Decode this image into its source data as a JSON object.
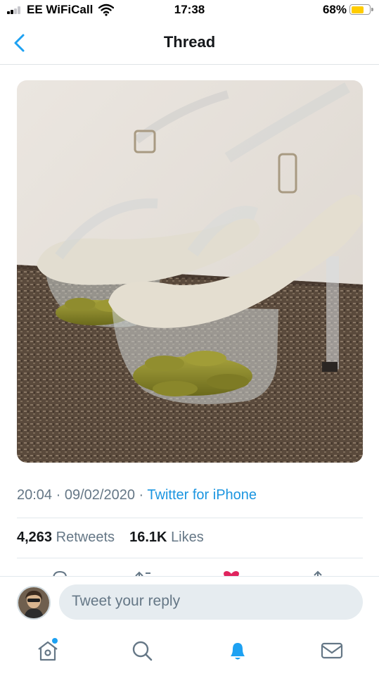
{
  "status_bar": {
    "carrier": "EE WiFiCall",
    "time": "17:38",
    "battery_pct": "68%",
    "battery_level": 0.68,
    "icons": [
      "cell-signal-icon",
      "wifi-icon",
      "battery-icon"
    ]
  },
  "nav": {
    "title": "Thread",
    "back_icon": "chevron-left-icon"
  },
  "tweet": {
    "time": "20:04",
    "date": "09/02/2020",
    "separator": "·",
    "source": "Twitter for iPhone",
    "retweets_count": "4,263",
    "retweets_label": "Retweets",
    "likes_count": "16.1K",
    "likes_label": "Likes"
  },
  "reply": {
    "placeholder": "Tweet your reply"
  },
  "tab_bar": {
    "items": [
      "home-icon",
      "search-icon",
      "notifications-icon",
      "messages-icon"
    ],
    "active": "notifications-icon"
  },
  "colors": {
    "accent": "#1da1f2",
    "link": "#1b95e0",
    "secondary_text": "#657786",
    "like": "#e0245e",
    "battery": "#ffcc00"
  }
}
